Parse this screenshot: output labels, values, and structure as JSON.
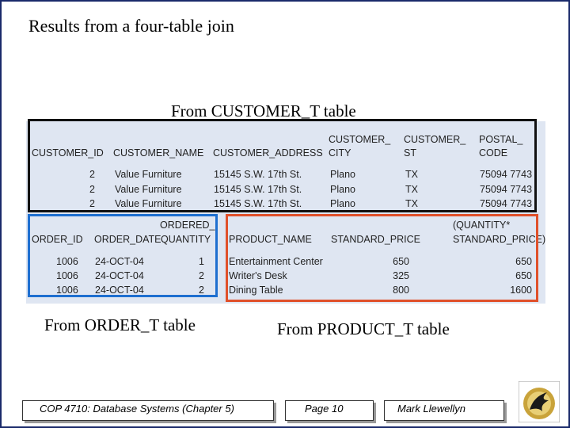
{
  "title": "Results from a four-table join",
  "captions": {
    "customer": "From CUSTOMER_T table",
    "order": "From ORDER_T table",
    "product": "From PRODUCT_T table"
  },
  "headers": {
    "customer_id": "CUSTOMER_ID",
    "customer_name": "CUSTOMER_NAME",
    "customer_address": "CUSTOMER_ADDRESS",
    "customer_city": [
      "CUSTOMER_",
      "CITY"
    ],
    "customer_st": [
      "CUSTOMER_",
      "ST"
    ],
    "postal_code": [
      "POSTAL_",
      "CODE"
    ],
    "order_id": "ORDER_ID",
    "order_date": "ORDER_DATE",
    "ordered_quantity": [
      "ORDERED_",
      "QUANTITY"
    ],
    "product_name": "PRODUCT_NAME",
    "standard_price": "STANDARD_PRICE",
    "extended": [
      "(QUANTITY*",
      "STANDARD_PRICE)"
    ]
  },
  "rows": [
    {
      "customer_id": "2",
      "customer_name": "Value Furniture",
      "address": "15145 S.W. 17th St.",
      "city": "Plano",
      "st": "TX",
      "postal": "75094 7743",
      "order_id": "1006",
      "order_date": "24-OCT-04",
      "quantity": "1",
      "product": "Entertainment Center",
      "price": "650",
      "extended": "650"
    },
    {
      "customer_id": "2",
      "customer_name": "Value Furniture",
      "address": "15145 S.W. 17th St.",
      "city": "Plano",
      "st": "TX",
      "postal": "75094 7743",
      "order_id": "1006",
      "order_date": "24-OCT-04",
      "quantity": "2",
      "product": "Writer's Desk",
      "price": "325",
      "extended": "650"
    },
    {
      "customer_id": "2",
      "customer_name": "Value Furniture",
      "address": "15145 S.W. 17th St.",
      "city": "Plano",
      "st": "TX",
      "postal": "75094 7743",
      "order_id": "1006",
      "order_date": "24-OCT-04",
      "quantity": "2",
      "product": "Dining Table",
      "price": "800",
      "extended": "1600"
    }
  ],
  "colors": {
    "customer_box": "#111111",
    "order_box": "#1e6fd0",
    "product_box": "#e0502a",
    "panel": "#dfe6f2"
  },
  "footer": {
    "course": "COP 4710: Database Systems  (Chapter 5)",
    "page": "Page 10",
    "author": "Mark Llewellyn"
  },
  "logo_icon": "pegasus-logo-icon"
}
